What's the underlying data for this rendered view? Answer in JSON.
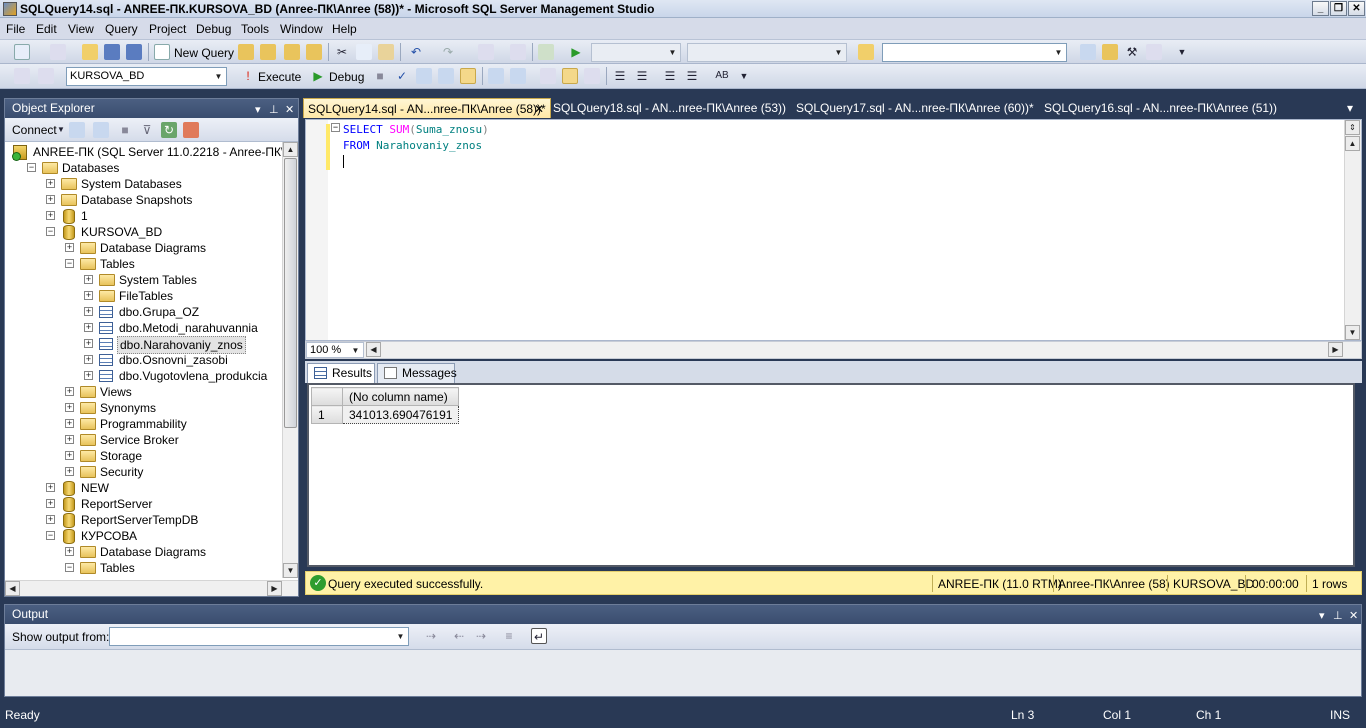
{
  "window": {
    "title": "SQLQuery14.sql - ANREE-ПК.KURSOVA_BD (Anree-ПК\\Anree (58))* - Microsoft SQL Server Management Studio"
  },
  "menu": [
    "File",
    "Edit",
    "View",
    "Query",
    "Project",
    "Debug",
    "Tools",
    "Window",
    "Help"
  ],
  "toolbar": {
    "new_query": "New Query",
    "database": "KURSOVA_BD",
    "execute": "Execute",
    "debug": "Debug"
  },
  "object_explorer": {
    "title": "Object Explorer",
    "connect": "Connect",
    "tree": [
      {
        "label": "ANREE-ПК (SQL Server 11.0.2218 - Anree-ПК\\Anree)",
        "icon": "server-icon",
        "level": 0,
        "state": "open"
      },
      {
        "label": "Databases",
        "icon": "folder-icon",
        "level": 1,
        "state": "open"
      },
      {
        "label": "System Databases",
        "icon": "folder-icon",
        "level": 2,
        "state": "closed"
      },
      {
        "label": "Database Snapshots",
        "icon": "folder-icon",
        "level": 2,
        "state": "closed"
      },
      {
        "label": "1",
        "icon": "database-icon",
        "level": 2,
        "state": "closed"
      },
      {
        "label": "KURSOVA_BD",
        "icon": "database-icon",
        "level": 2,
        "state": "open"
      },
      {
        "label": "Database Diagrams",
        "icon": "folder-icon",
        "level": 3,
        "state": "closed"
      },
      {
        "label": "Tables",
        "icon": "folder-icon",
        "level": 3,
        "state": "open"
      },
      {
        "label": "System Tables",
        "icon": "folder-icon",
        "level": 4,
        "state": "closed"
      },
      {
        "label": "FileTables",
        "icon": "folder-icon",
        "level": 4,
        "state": "closed"
      },
      {
        "label": "dbo.Grupa_OZ",
        "icon": "table-icon",
        "level": 4,
        "state": "closed"
      },
      {
        "label": "dbo.Metodi_narahuvannia",
        "icon": "table-icon",
        "level": 4,
        "state": "closed"
      },
      {
        "label": "dbo.Narahovaniy_znos",
        "icon": "table-icon",
        "level": 4,
        "state": "closed",
        "selected": true
      },
      {
        "label": "dbo.Osnovni_zasobi",
        "icon": "table-icon",
        "level": 4,
        "state": "closed"
      },
      {
        "label": "dbo.Vugotovlena_produkcia",
        "icon": "table-icon",
        "level": 4,
        "state": "closed"
      },
      {
        "label": "Views",
        "icon": "folder-icon",
        "level": 3,
        "state": "closed"
      },
      {
        "label": "Synonyms",
        "icon": "folder-icon",
        "level": 3,
        "state": "closed"
      },
      {
        "label": "Programmability",
        "icon": "folder-icon",
        "level": 3,
        "state": "closed"
      },
      {
        "label": "Service Broker",
        "icon": "folder-icon",
        "level": 3,
        "state": "closed"
      },
      {
        "label": "Storage",
        "icon": "folder-icon",
        "level": 3,
        "state": "closed"
      },
      {
        "label": "Security",
        "icon": "folder-icon",
        "level": 3,
        "state": "closed"
      },
      {
        "label": "NEW",
        "icon": "database-icon",
        "level": 2,
        "state": "closed"
      },
      {
        "label": "ReportServer",
        "icon": "database-icon",
        "level": 2,
        "state": "closed"
      },
      {
        "label": "ReportServerTempDB",
        "icon": "database-icon",
        "level": 2,
        "state": "closed"
      },
      {
        "label": "КУРСОВА",
        "icon": "database-icon",
        "level": 2,
        "state": "open"
      },
      {
        "label": "Database Diagrams",
        "icon": "folder-icon",
        "level": 3,
        "state": "closed"
      },
      {
        "label": "Tables",
        "icon": "folder-icon",
        "level": 3,
        "state": "open"
      }
    ]
  },
  "doc_tabs": [
    {
      "label": "SQLQuery14.sql - AN...nree-ПК\\Anree (58))*",
      "active": true
    },
    {
      "label": "SQLQuery18.sql - AN...nree-ПК\\Anree (53))",
      "active": false
    },
    {
      "label": "SQLQuery17.sql - AN...nree-ПК\\Anree (60))*",
      "active": false
    },
    {
      "label": "SQLQuery16.sql - AN...nree-ПК\\Anree (51))",
      "active": false
    }
  ],
  "editor": {
    "line1": {
      "kw": "SELECT",
      "fn": "SUM",
      "open": "(",
      "col": "Suma_znosu",
      "close": ")"
    },
    "line2": {
      "kw": "FROM",
      "table": "Narahovaniy_znos"
    },
    "zoom": "100 %"
  },
  "results": {
    "tabs": [
      "Results",
      "Messages"
    ],
    "column": "(No column name)",
    "row_num": "1",
    "value": "341013.690476191"
  },
  "query_status": {
    "message": "Query executed successfully.",
    "server": "ANREE-ПК (11.0 RTM)",
    "user": "Anree-ПК\\Anree (58)",
    "database": "KURSOVA_BD",
    "time": "00:00:00",
    "rows": "1 rows"
  },
  "output": {
    "title": "Output",
    "show_from": "Show output from:"
  },
  "status_bar": {
    "ready": "Ready",
    "ln": "Ln 3",
    "col": "Col 1",
    "ch": "Ch 1",
    "ins": "INS"
  }
}
